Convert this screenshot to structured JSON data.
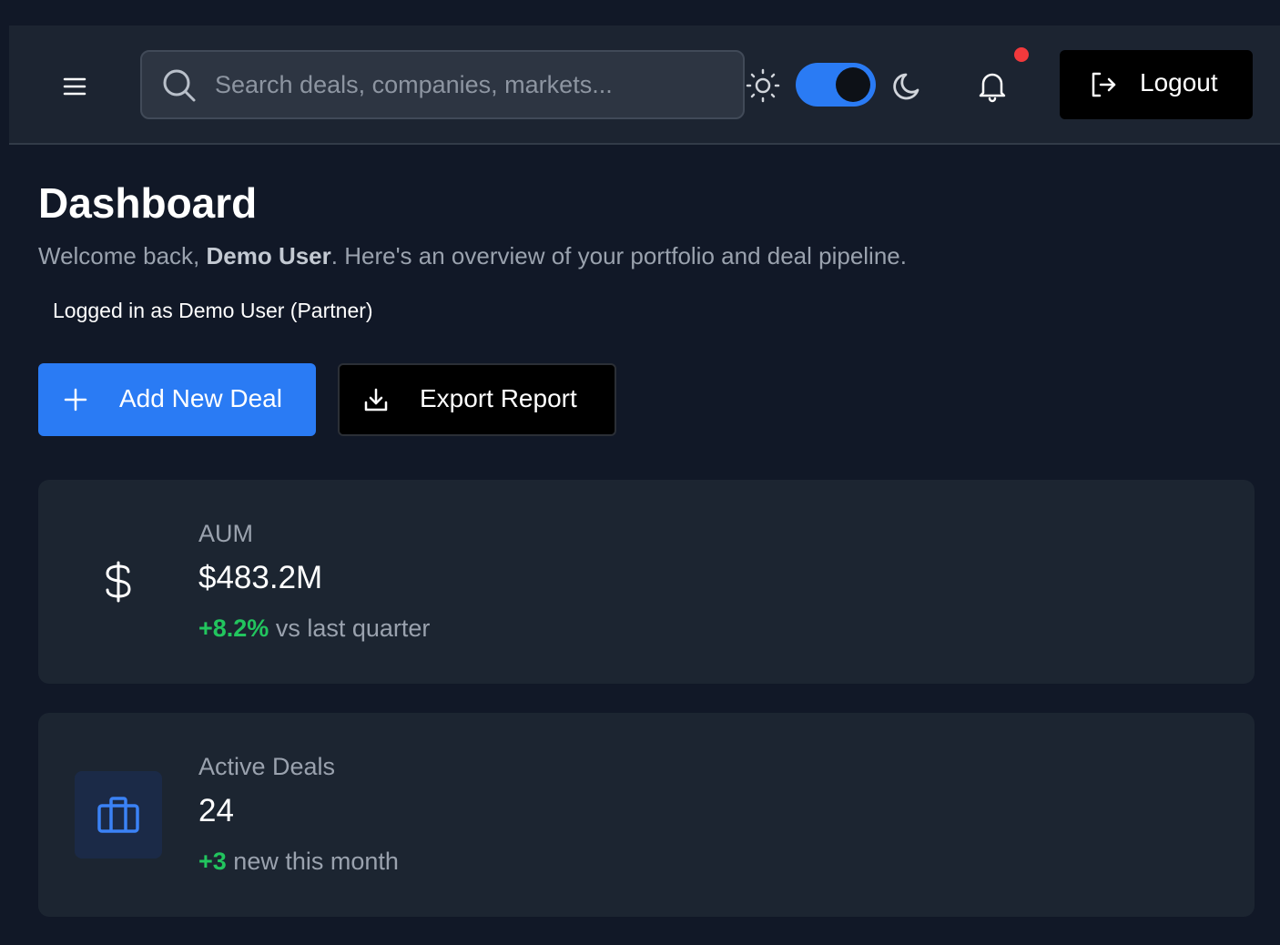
{
  "header": {
    "search": {
      "placeholder": "Search deals, companies, markets...",
      "value": ""
    },
    "theme_toggle": {
      "mode": "dark"
    },
    "notifications": {
      "has_unread": true
    },
    "logout_label": "Logout"
  },
  "main": {
    "title": "Dashboard",
    "welcome": {
      "prefix": "Welcome back, ",
      "user": "Demo User",
      "suffix": ". Here's an overview of your portfolio and deal pipeline."
    },
    "logged_in": "Logged in as Demo User (Partner)",
    "actions": {
      "add_deal": "Add New Deal",
      "export_report": "Export Report"
    },
    "stats": {
      "aum": {
        "label": "AUM",
        "value": "$483.2M",
        "delta": "+8.2%",
        "delta_text": " vs last quarter",
        "icon": "dollar-icon"
      },
      "active_deals": {
        "label": "Active Deals",
        "value": "24",
        "delta": "+3",
        "delta_text": " new this month",
        "icon": "briefcase-icon"
      }
    }
  },
  "colors": {
    "background": "#111827",
    "header_bg": "#1c2431",
    "card_bg": "#1c2531",
    "accent": "#2a7bf4",
    "positive": "#22c55e",
    "notification": "#f2393c",
    "muted_text": "#9aa2ae"
  }
}
